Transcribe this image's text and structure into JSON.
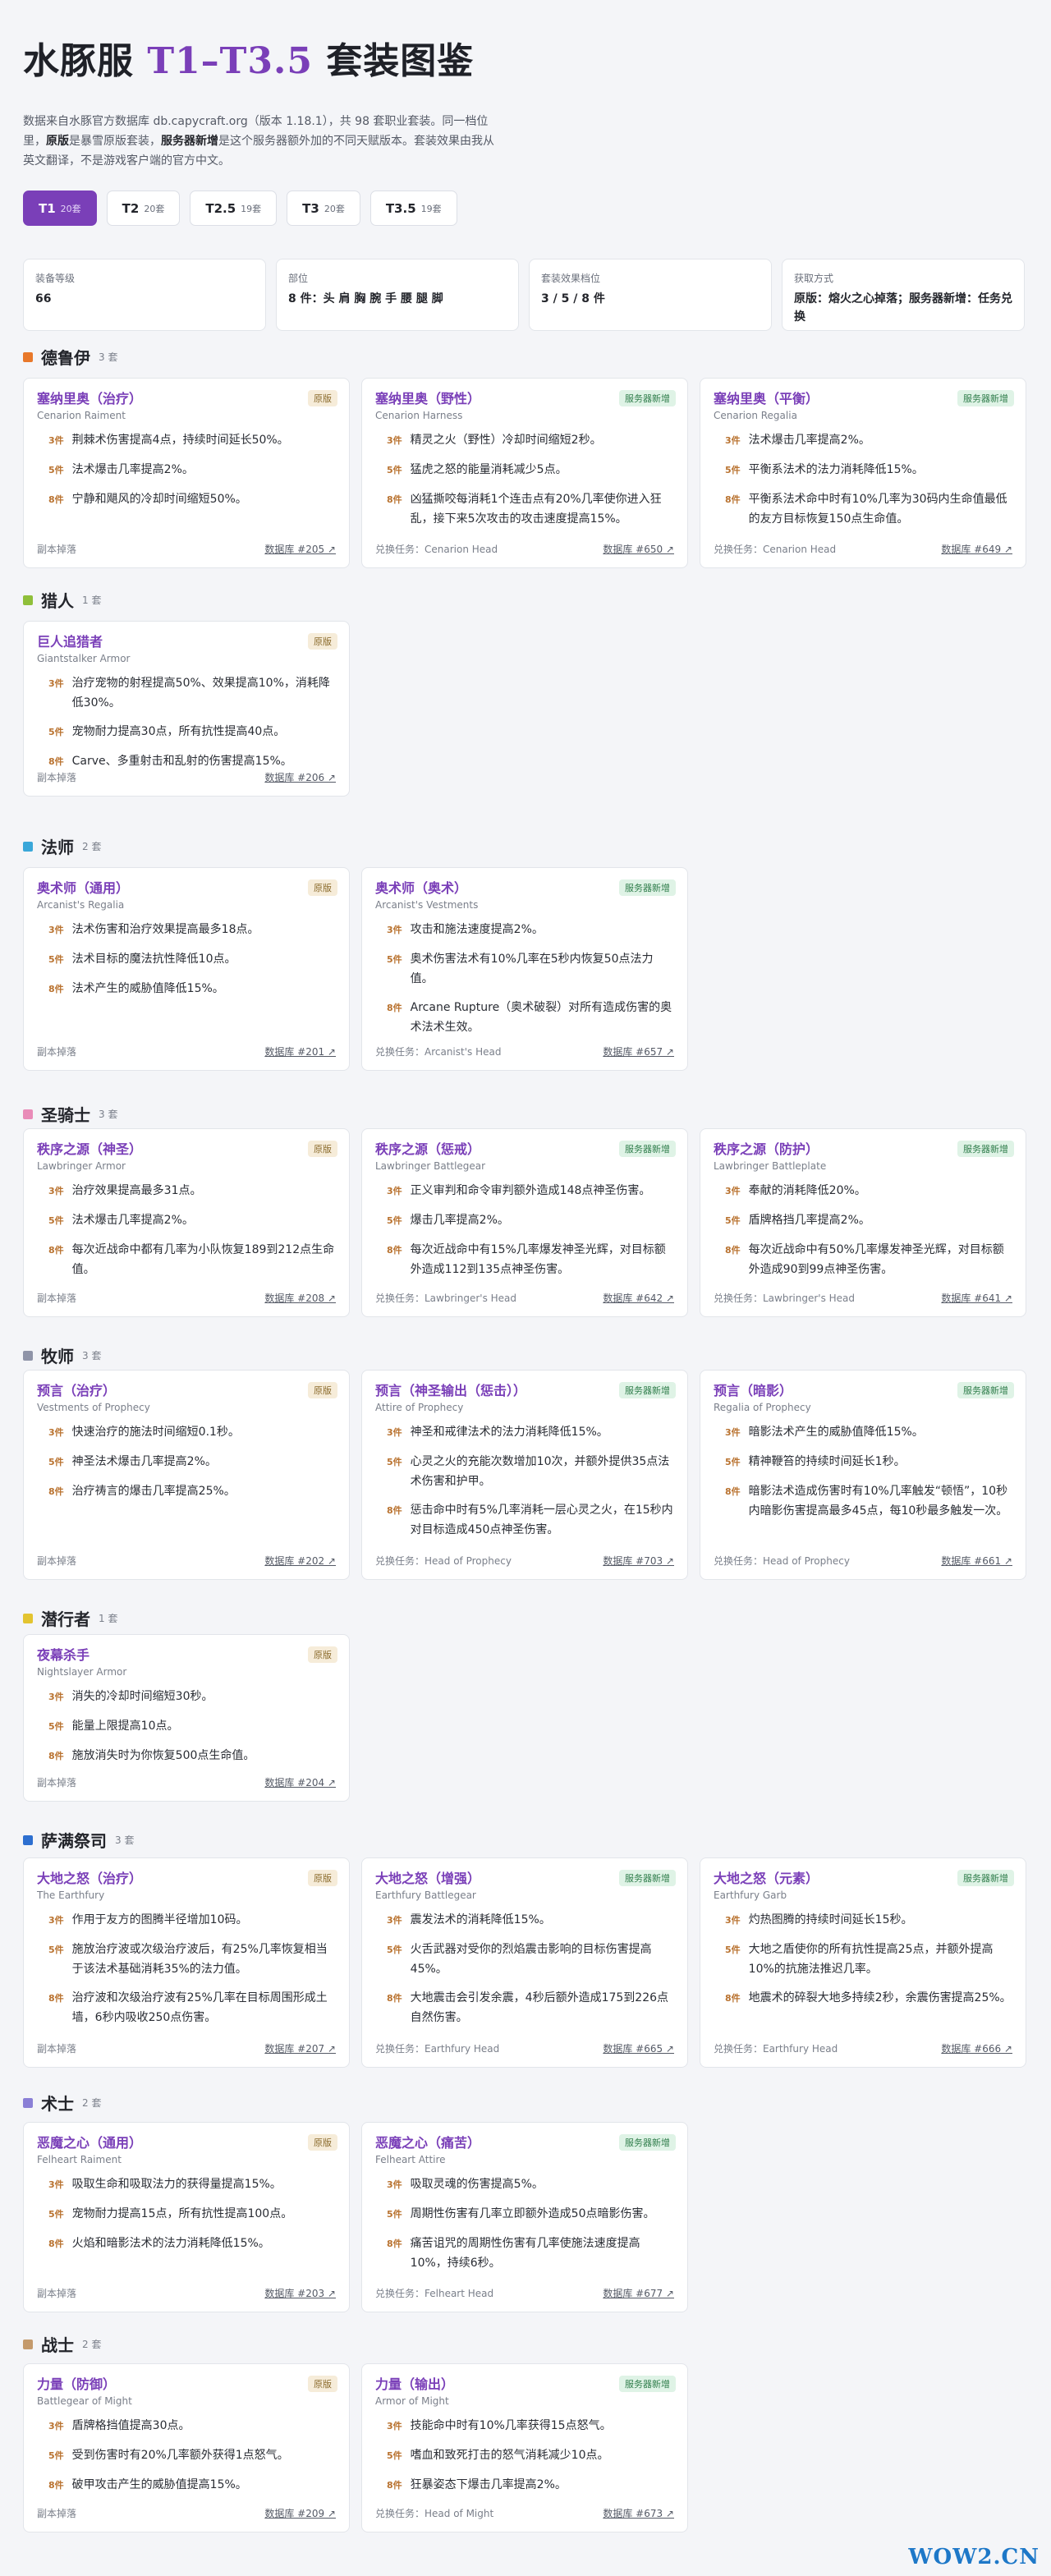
{
  "header": {
    "title_prefix": "水豚服 ",
    "title_highlight": "T1–T3.5",
    "title_suffix": " 套装图鉴",
    "intro_1": "数据来自水豚官方数据库 db.capycraft.org（版本 1.18.1），共 98 套职业套装。同一档位里，",
    "intro_b1": "原版",
    "intro_2": "是暴雪原版套装，",
    "intro_b2": "服务器新增",
    "intro_3": "是这个服务器额外加的不同天赋版本。套装效果由我从英文翻译，不是游戏客户端的官方中文。"
  },
  "tabs": [
    {
      "label": "T1",
      "count": "20套"
    },
    {
      "label": "T2",
      "count": "20套"
    },
    {
      "label": "T2.5",
      "count": "19套"
    },
    {
      "label": "T3",
      "count": "20套"
    },
    {
      "label": "T3.5",
      "count": "19套"
    }
  ],
  "info": [
    {
      "label": "装备等级",
      "value": "66"
    },
    {
      "label": "部位",
      "value": "8 件：头 肩 胸 腕 手 腰 腿 脚"
    },
    {
      "label": "套装效果档位",
      "value": "3 / 5 / 8 件"
    },
    {
      "label": "获取方式",
      "value": "原版：熔火之心掉落；服务器新增：任务兑换"
    }
  ],
  "badges": {
    "orig": "原版",
    "srv": "服务器新增"
  },
  "pieces": {
    "p3": "3件",
    "p5": "5件",
    "p8": "8件"
  },
  "colors": {
    "accent": "#7a3fb8",
    "druid": "#e8782a",
    "hunter": "#8fbf3a",
    "mage": "#3aa7d9",
    "paladin": "#e98bb8",
    "priest": "#8f94a8",
    "rogue": "#e3c430",
    "shaman": "#2d6fd0",
    "warlock": "#8a7fd6",
    "warrior": "#c49a6c"
  },
  "sections": [
    {
      "name": "德鲁伊",
      "count": "3 套",
      "cards": [
        {
          "title": "塞纳里奥（治疗）",
          "en": "Cenarion Raiment",
          "badge": "orig",
          "b3": "荆棘术伤害提高4点，持续时间延长50%。",
          "b5": "法术爆击几率提高2%。",
          "b8": "宁静和飓风的冷却时间缩短50%。",
          "src": "副本掉落",
          "db": "数据库 #205 ↗"
        },
        {
          "title": "塞纳里奥（野性）",
          "en": "Cenarion Harness",
          "badge": "srv",
          "b3": "精灵之火（野性）冷却时间缩短2秒。",
          "b5": "猛虎之怒的能量消耗减少5点。",
          "b8": "凶猛撕咬每消耗1个连击点有20%几率使你进入狂乱，接下来5次攻击的攻击速度提高15%。",
          "src": "兑换任务：Cenarion Head",
          "db": "数据库 #650 ↗"
        },
        {
          "title": "塞纳里奥（平衡）",
          "en": "Cenarion Regalia",
          "badge": "srv",
          "b3": "法术爆击几率提高2%。",
          "b5": "平衡系法术的法力消耗降低15%。",
          "b8": "平衡系法术命中时有10%几率为30码内生命值最低的友方目标恢复150点生命值。",
          "src": "兑换任务：Cenarion Head",
          "db": "数据库 #649 ↗"
        }
      ]
    },
    {
      "name": "猎人",
      "count": "1 套",
      "cards": [
        {
          "title": "巨人追猎者",
          "en": "Giantstalker Armor",
          "badge": "orig",
          "b3": "治疗宠物的射程提高50%、效果提高10%，消耗降低30%。",
          "b5": "宠物耐力提高30点，所有抗性提高40点。",
          "b8": "Carve、多重射击和乱射的伤害提高15%。",
          "src": "副本掉落",
          "db": "数据库 #206 ↗"
        }
      ]
    },
    {
      "name": "法师",
      "count": "2 套",
      "cards": [
        {
          "title": "奥术师（通用）",
          "en": "Arcanist's Regalia",
          "badge": "orig",
          "b3": "法术伤害和治疗效果提高最多18点。",
          "b5": "法术目标的魔法抗性降低10点。",
          "b8": "法术产生的威胁值降低15%。",
          "src": "副本掉落",
          "db": "数据库 #201 ↗"
        },
        {
          "title": "奥术师（奥术）",
          "en": "Arcanist's Vestments",
          "badge": "srv",
          "b3": "攻击和施法速度提高2%。",
          "b5": "奥术伤害法术有10%几率在5秒内恢复50点法力值。",
          "b8": "Arcane Rupture（奥术破裂）对所有造成伤害的奥术法术生效。",
          "src": "兑换任务：Arcanist's Head",
          "db": "数据库 #657 ↗"
        }
      ]
    },
    {
      "name": "圣骑士",
      "count": "3 套",
      "cards": [
        {
          "title": "秩序之源（神圣）",
          "en": "Lawbringer Armor",
          "badge": "orig",
          "b3": "治疗效果提高最多31点。",
          "b5": "法术爆击几率提高2%。",
          "b8": "每次近战命中都有几率为小队恢复189到212点生命值。",
          "src": "副本掉落",
          "db": "数据库 #208 ↗"
        },
        {
          "title": "秩序之源（惩戒）",
          "en": "Lawbringer Battlegear",
          "badge": "srv",
          "b3": "正义审判和命令审判额外造成148点神圣伤害。",
          "b5": "爆击几率提高2%。",
          "b8": "每次近战命中有15%几率爆发神圣光辉，对目标额外造成112到135点神圣伤害。",
          "src": "兑换任务：Lawbringer's Head",
          "db": "数据库 #642 ↗"
        },
        {
          "title": "秩序之源（防护）",
          "en": "Lawbringer Battleplate",
          "badge": "srv",
          "b3": "奉献的消耗降低20%。",
          "b5": "盾牌格挡几率提高2%。",
          "b8": "每次近战命中有50%几率爆发神圣光辉，对目标额外造成90到99点神圣伤害。",
          "src": "兑换任务：Lawbringer's Head",
          "db": "数据库 #641 ↗"
        }
      ]
    },
    {
      "name": "牧师",
      "count": "3 套",
      "cards": [
        {
          "title": "预言（治疗）",
          "en": "Vestments of Prophecy",
          "badge": "orig",
          "b3": "快速治疗的施法时间缩短0.1秒。",
          "b5": "神圣法术爆击几率提高2%。",
          "b8": "治疗祷言的爆击几率提高25%。",
          "src": "副本掉落",
          "db": "数据库 #202 ↗"
        },
        {
          "title": "预言（神圣输出（惩击））",
          "en": "Attire of Prophecy",
          "badge": "srv",
          "b3": "神圣和戒律法术的法力消耗降低15%。",
          "b5": "心灵之火的充能次数增加10次，并额外提供35点法术伤害和护甲。",
          "b8": "惩击命中时有5%几率消耗一层心灵之火，在15秒内对目标造成450点神圣伤害。",
          "src": "兑换任务：Head of Prophecy",
          "db": "数据库 #703 ↗"
        },
        {
          "title": "预言（暗影）",
          "en": "Regalia of Prophecy",
          "badge": "srv",
          "b3": "暗影法术产生的威胁值降低15%。",
          "b5": "精神鞭笞的持续时间延长1秒。",
          "b8": "暗影法术造成伤害时有10%几率触发“顿悟”，10秒内暗影伤害提高最多45点，每10秒最多触发一次。",
          "src": "兑换任务：Head of Prophecy",
          "db": "数据库 #661 ↗"
        }
      ]
    },
    {
      "name": "潜行者",
      "count": "1 套",
      "cards": [
        {
          "title": "夜幕杀手",
          "en": "Nightslayer Armor",
          "badge": "orig",
          "b3": "消失的冷却时间缩短30秒。",
          "b5": "能量上限提高10点。",
          "b8": "施放消失时为你恢复500点生命值。",
          "src": "副本掉落",
          "db": "数据库 #204 ↗"
        }
      ]
    },
    {
      "name": "萨满祭司",
      "count": "3 套",
      "cards": [
        {
          "title": "大地之怒（治疗）",
          "en": "The Earthfury",
          "badge": "orig",
          "b3": "作用于友方的图腾半径增加10码。",
          "b5": "施放治疗波或次级治疗波后，有25%几率恢复相当于该法术基础消耗35%的法力值。",
          "b8": "治疗波和次级治疗波有25%几率在目标周围形成土墙，6秒内吸收250点伤害。",
          "src": "副本掉落",
          "db": "数据库 #207 ↗"
        },
        {
          "title": "大地之怒（增强）",
          "en": "Earthfury Battlegear",
          "badge": "srv",
          "b3": "震发法术的消耗降低15%。",
          "b5": "火舌武器对受你的烈焰震击影响的目标伤害提高45%。",
          "b8": "大地震击会引发余震，4秒后额外造成175到226点自然伤害。",
          "src": "兑换任务：Earthfury Head",
          "db": "数据库 #665 ↗"
        },
        {
          "title": "大地之怒（元素）",
          "en": "Earthfury Garb",
          "badge": "srv",
          "b3": "灼热图腾的持续时间延长15秒。",
          "b5": "大地之盾使你的所有抗性提高25点，并额外提高10%的抗施法推迟几率。",
          "b8": "地震术的碎裂大地多持续2秒，余震伤害提高25%。",
          "src": "兑换任务：Earthfury Head",
          "db": "数据库 #666 ↗"
        }
      ]
    },
    {
      "name": "术士",
      "count": "2 套",
      "cards": [
        {
          "title": "恶魔之心（通用）",
          "en": "Felheart Raiment",
          "badge": "orig",
          "b3": "吸取生命和吸取法力的获得量提高15%。",
          "b5": "宠物耐力提高15点，所有抗性提高100点。",
          "b8": "火焰和暗影法术的法力消耗降低15%。",
          "src": "副本掉落",
          "db": "数据库 #203 ↗"
        },
        {
          "title": "恶魔之心（痛苦）",
          "en": "Felheart Attire",
          "badge": "srv",
          "b3": "吸取灵魂的伤害提高5%。",
          "b5": "周期性伤害有几率立即额外造成50点暗影伤害。",
          "b8": "痛苦诅咒的周期性伤害有几率使施法速度提高10%，持续6秒。",
          "src": "兑换任务：Felheart Head",
          "db": "数据库 #677 ↗"
        }
      ]
    },
    {
      "name": "战士",
      "count": "2 套",
      "cards": [
        {
          "title": "力量（防御）",
          "en": "Battlegear of Might",
          "badge": "orig",
          "b3": "盾牌格挡值提高30点。",
          "b5": "受到伤害时有20%几率额外获得1点怒气。",
          "b8": "破甲攻击产生的威胁值提高15%。",
          "src": "副本掉落",
          "db": "数据库 #209 ↗"
        },
        {
          "title": "力量（输出）",
          "en": "Armor of Might",
          "badge": "srv",
          "b3": "技能命中时有10%几率获得15点怒气。",
          "b5": "嗜血和致死打击的怒气消耗减少10点。",
          "b8": "狂暴姿态下爆击几率提高2%。",
          "src": "兑换任务：Head of Might",
          "db": "数据库 #673 ↗"
        }
      ]
    }
  ],
  "watermark": "WOW2.CN"
}
